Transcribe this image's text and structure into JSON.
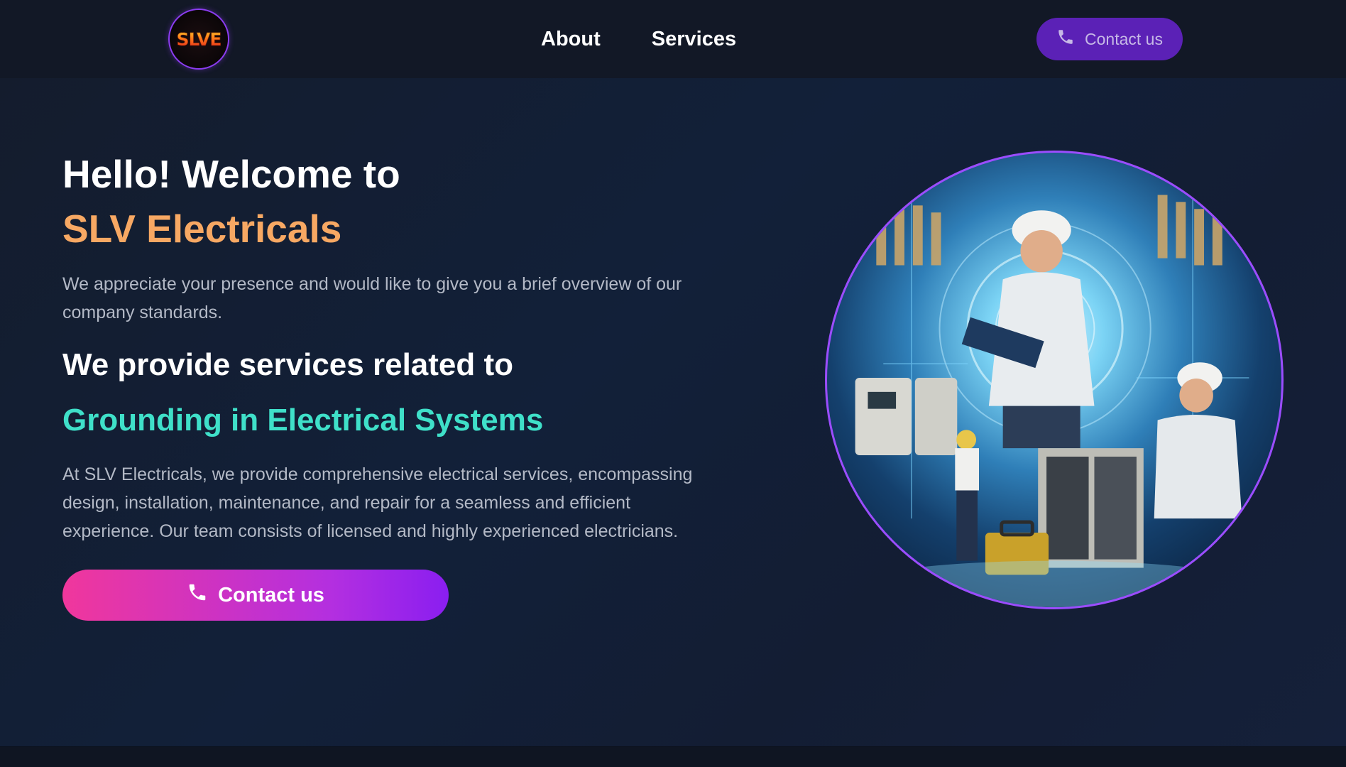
{
  "brand": {
    "logo_text": "SLVE"
  },
  "nav": {
    "links": [
      "About",
      "Services"
    ],
    "contact_label": "Contact us"
  },
  "hero": {
    "greeting": "Hello! Welcome to",
    "company": "SLV Electricals",
    "intro": "We appreciate your presence and would like to give you a brief overview of our company standards.",
    "services_heading": "We provide services related to",
    "service_name": "Grounding in Electrical Systems",
    "description": "At SLV Electricals, we provide comprehensive electrical services, encompassing design, installation, maintenance, and repair for a seamless and efficient experience. Our team consists of licensed and highly experienced electricians.",
    "cta_label": "Contact us"
  },
  "colors": {
    "accent_orange": "#f7a863",
    "accent_teal": "#3fe0c9",
    "nav_button": "#5b21b6",
    "cta_gradient_start": "#f0379c",
    "cta_gradient_end": "#8a1ef0"
  },
  "icons": {
    "contact_icon": "phone-icon"
  }
}
